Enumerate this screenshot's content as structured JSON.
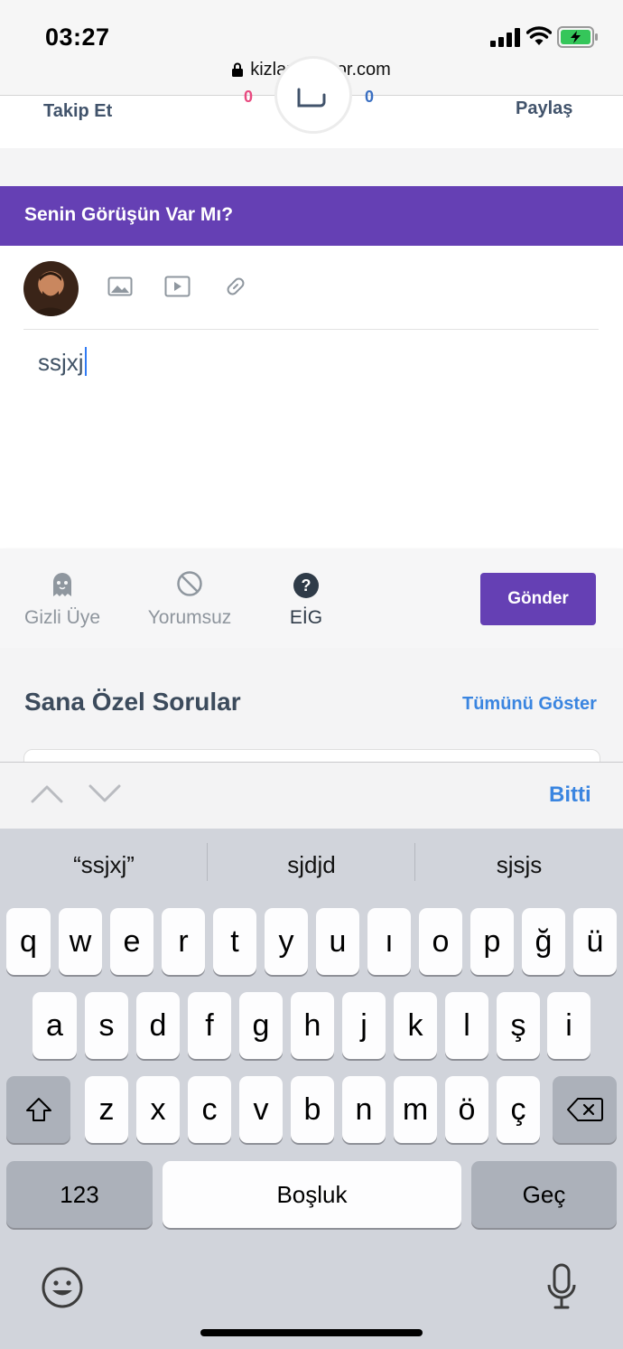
{
  "status_bar": {
    "time": "03:27",
    "url": "kizlarsoruyor.com"
  },
  "top_actions": {
    "follow": "Takip Et",
    "share": "Paylaş",
    "left_count": "0",
    "right_count": "0"
  },
  "opinion": {
    "title": "Senin Görüşün Var Mı?",
    "typed_text": "ssjxj",
    "tools": [
      "image-icon",
      "video-icon",
      "link-icon"
    ]
  },
  "options": {
    "anonymous": "Gizli Üye",
    "no_comments": "Yorumsuz",
    "eig": "EİG",
    "send": "Gönder"
  },
  "section": {
    "title": "Sana Özel Sorular",
    "show_all": "Tümünü Göster"
  },
  "accessory": {
    "done": "Bitti"
  },
  "keyboard": {
    "suggestions": [
      "“ssjxj”",
      "sjdjd",
      "sjsjs"
    ],
    "row1": [
      "q",
      "w",
      "e",
      "r",
      "t",
      "y",
      "u",
      "ı",
      "o",
      "p",
      "ğ",
      "ü"
    ],
    "row2": [
      "a",
      "s",
      "d",
      "f",
      "g",
      "h",
      "j",
      "k",
      "l",
      "ş",
      "i"
    ],
    "row3": [
      "z",
      "x",
      "c",
      "v",
      "b",
      "n",
      "m",
      "ö",
      "ç"
    ],
    "numbers": "123",
    "space": "Boşluk",
    "go": "Geç"
  },
  "colors": {
    "accent": "#6540b4",
    "link": "#3a85e0",
    "text": "#41536b"
  }
}
